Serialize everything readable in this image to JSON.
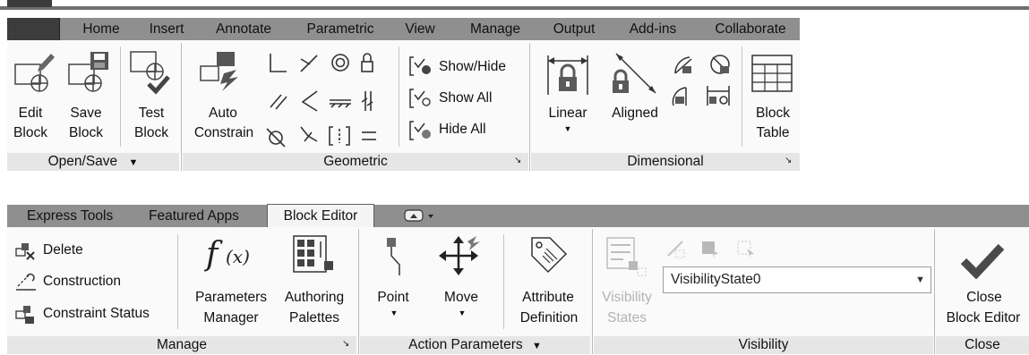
{
  "top_ribbon": {
    "tabs": [
      "Home",
      "Insert",
      "Annotate",
      "Parametric",
      "View",
      "Manage",
      "Output",
      "Add-ins",
      "Collaborate"
    ],
    "open_save": {
      "edit": [
        "Edit",
        "Block"
      ],
      "save": [
        "Save",
        "Block"
      ],
      "test": [
        "Test",
        "Block"
      ],
      "panel": "Open/Save"
    },
    "geometric": {
      "auto": [
        "Auto",
        "Constrain"
      ],
      "panel": "Geometric"
    },
    "show_hide": {
      "show_hide": "Show/Hide",
      "show_all": "Show All",
      "hide_all": "Hide All"
    },
    "dimensional": {
      "linear": "Linear",
      "aligned": "Aligned",
      "panel": "Dimensional"
    },
    "block_table": [
      "Block",
      "Table"
    ]
  },
  "bottom_ribbon": {
    "tabs": [
      "Express Tools",
      "Featured Apps",
      "Block Editor"
    ],
    "active_tab": "Block Editor",
    "manage": {
      "delete": "Delete",
      "construction": "Construction",
      "constraint_status": "Constraint Status",
      "parameters_manager": [
        "Parameters",
        "Manager"
      ],
      "authoring_palettes": [
        "Authoring",
        "Palettes"
      ],
      "panel": "Manage"
    },
    "action_parameters": {
      "point": "Point",
      "move": "Move",
      "attribute": [
        "Attribute",
        "Definition"
      ],
      "panel": "Action Parameters"
    },
    "visibility": {
      "states": [
        "Visibility",
        "States"
      ],
      "selected_state": "VisibilityState0",
      "panel": "Visibility"
    },
    "close": {
      "label": [
        "Close",
        "Block Editor"
      ],
      "panel": "Close"
    }
  },
  "colors": {
    "tabbar": "#8f8f8f",
    "ribbon": "#fafafa",
    "panel_footer": "#e6e6e6",
    "accent_lock": "#5a5a5a"
  }
}
